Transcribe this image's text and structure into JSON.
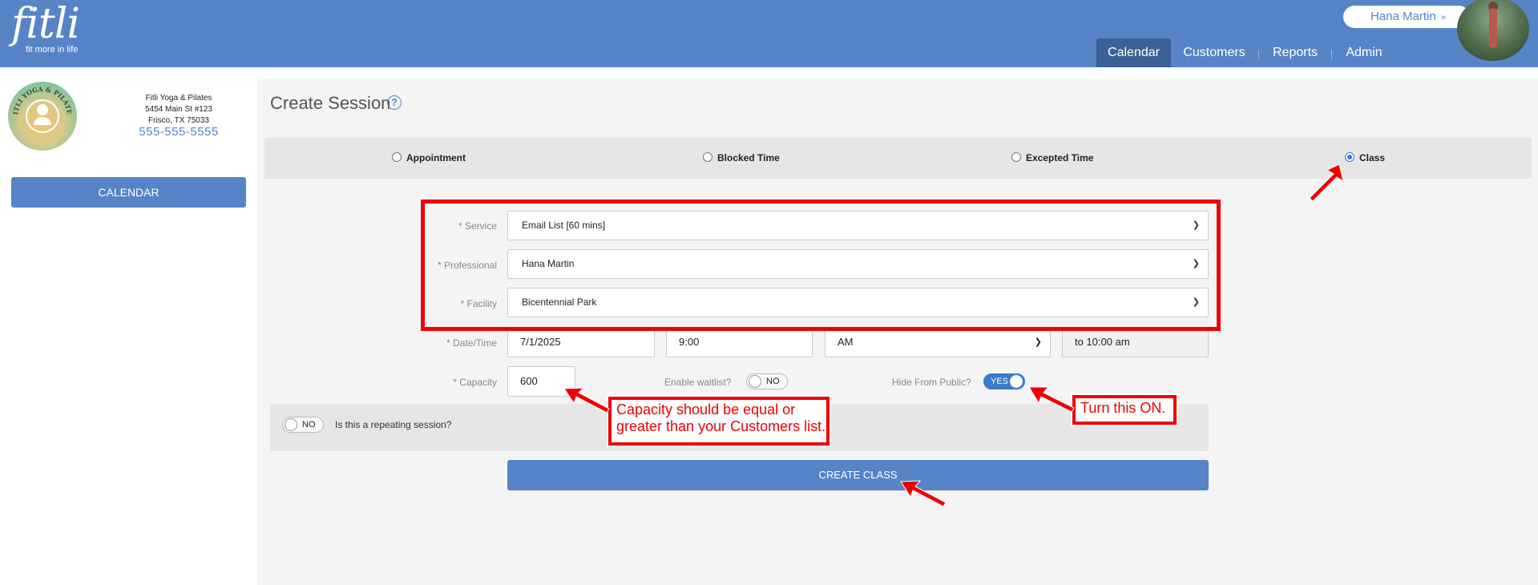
{
  "brand": {
    "name": "fitli",
    "tagline": "fit more in life"
  },
  "header": {
    "user_name": "Hana Martin",
    "user_chevron": "»",
    "nav": [
      {
        "label": "Calendar",
        "active": true
      },
      {
        "label": "Customers"
      },
      {
        "label": "Reports"
      },
      {
        "label": "Admin"
      }
    ]
  },
  "sidebar": {
    "studio_logo_text": "FITLI YOGA & PILATES",
    "studio_name": "Fitli Yoga & Pilates",
    "address_line1": "5454 Main St #123",
    "address_line2": "Frisco, TX 75033",
    "phone": "555-555-5555",
    "calendar_button": "CALENDAR"
  },
  "page": {
    "title": "Create Session",
    "help_icon": "?",
    "session_types": [
      {
        "label": "Appointment",
        "selected": false
      },
      {
        "label": "Blocked Time",
        "selected": false
      },
      {
        "label": "Excepted Time",
        "selected": false
      },
      {
        "label": "Class",
        "selected": true
      }
    ]
  },
  "form": {
    "service_label": "* Service",
    "service_value": "Email List [60 mins]",
    "professional_label": "* Professional",
    "professional_value": "Hana Martin",
    "facility_label": "* Facility",
    "facility_value": "Bicentennial Park",
    "datetime_label": "* Date/Time",
    "date_value": "7/1/2025",
    "time_value": "9:00",
    "ampm_value": "AM",
    "end_time_value": "to 10:00 am",
    "capacity_label": "* Capacity",
    "capacity_value": "600",
    "waitlist_label": "Enable waitlist?",
    "waitlist_value": "NO",
    "hide_label": "Hide From Public?",
    "hide_value": "YES",
    "repeat_toggle_value": "NO",
    "repeat_label": "Is this a repeating session?",
    "create_button": "CREATE CLASS"
  },
  "annotations": {
    "capacity_note_line1": "Capacity should be equal or",
    "capacity_note_line2": "greater than your Customers list.",
    "turn_on_note": "Turn this ON."
  },
  "colors": {
    "header_blue": "#5784c6",
    "nav_active": "#3c6196",
    "annotation_red": "#ee0000",
    "toggle_on": "#3c7bc7"
  }
}
